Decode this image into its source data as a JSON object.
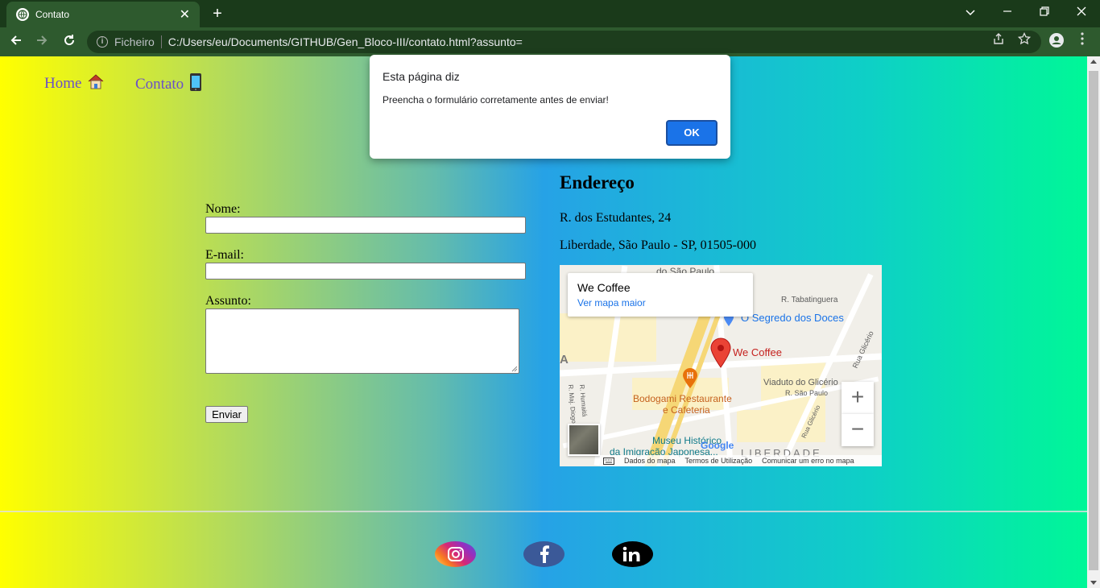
{
  "browser": {
    "tab_title": "Contato",
    "tab_close": "✕",
    "new_tab": "+",
    "omnibox_scheme": "Ficheiro",
    "url": "C:/Users/eu/Documents/GITHUB/Gen_Bloco-III/contato.html?assunto="
  },
  "nav": {
    "home_label": "Home",
    "contato_label": "Contato"
  },
  "form": {
    "nome_label": "Nome:",
    "email_label": "E-mail:",
    "assunto_label": "Assunto:",
    "submit_label": "Enviar"
  },
  "address": {
    "title": "Endereço",
    "line1": "R. dos Estudantes, 24",
    "line2": "Liberdade, São Paulo - SP, 01505-000"
  },
  "map": {
    "place_name": "We Coffee",
    "larger_map_link": "Ver mapa maior",
    "labels": {
      "top_partial": "do São Paulo",
      "tabatinguera": "R. Tabatinguera",
      "segredo": "O Segredo dos Doces",
      "wecoffee": "We Coffee",
      "glicerio_street": "Rua Glicério",
      "viaduto": "Viaduto do Glicério",
      "sao_paulo_street": "R. São Paulo",
      "bodogami1": "Bodogami Restaurante",
      "bodogami2": "e Cafeteria",
      "museu1": "Museu Histórico",
      "museu2": "da Imigração Japonesa...",
      "liberdade": "LIBERDADE",
      "humaita": "R. Humaitá",
      "maj_diogo": "R. Maj. Diogo",
      "glicerio2": "Rua Glicério"
    },
    "footer": {
      "dados": "Dados do mapa",
      "termos": "Termos de Utilização",
      "erro": "Comunicar um erro no mapa"
    },
    "zoom_in": "+",
    "zoom_out": "−"
  },
  "dialog": {
    "title": "Esta página diz",
    "message": "Preencha o formulário corretamente antes de enviar!",
    "ok_label": "OK"
  },
  "colors": {
    "gradient_start": "#ffff00",
    "gradient_mid": "#26a2e6",
    "gradient_end": "#00f797",
    "nav_link": "#6a4fc8",
    "dialog_button": "#1a73e8"
  }
}
